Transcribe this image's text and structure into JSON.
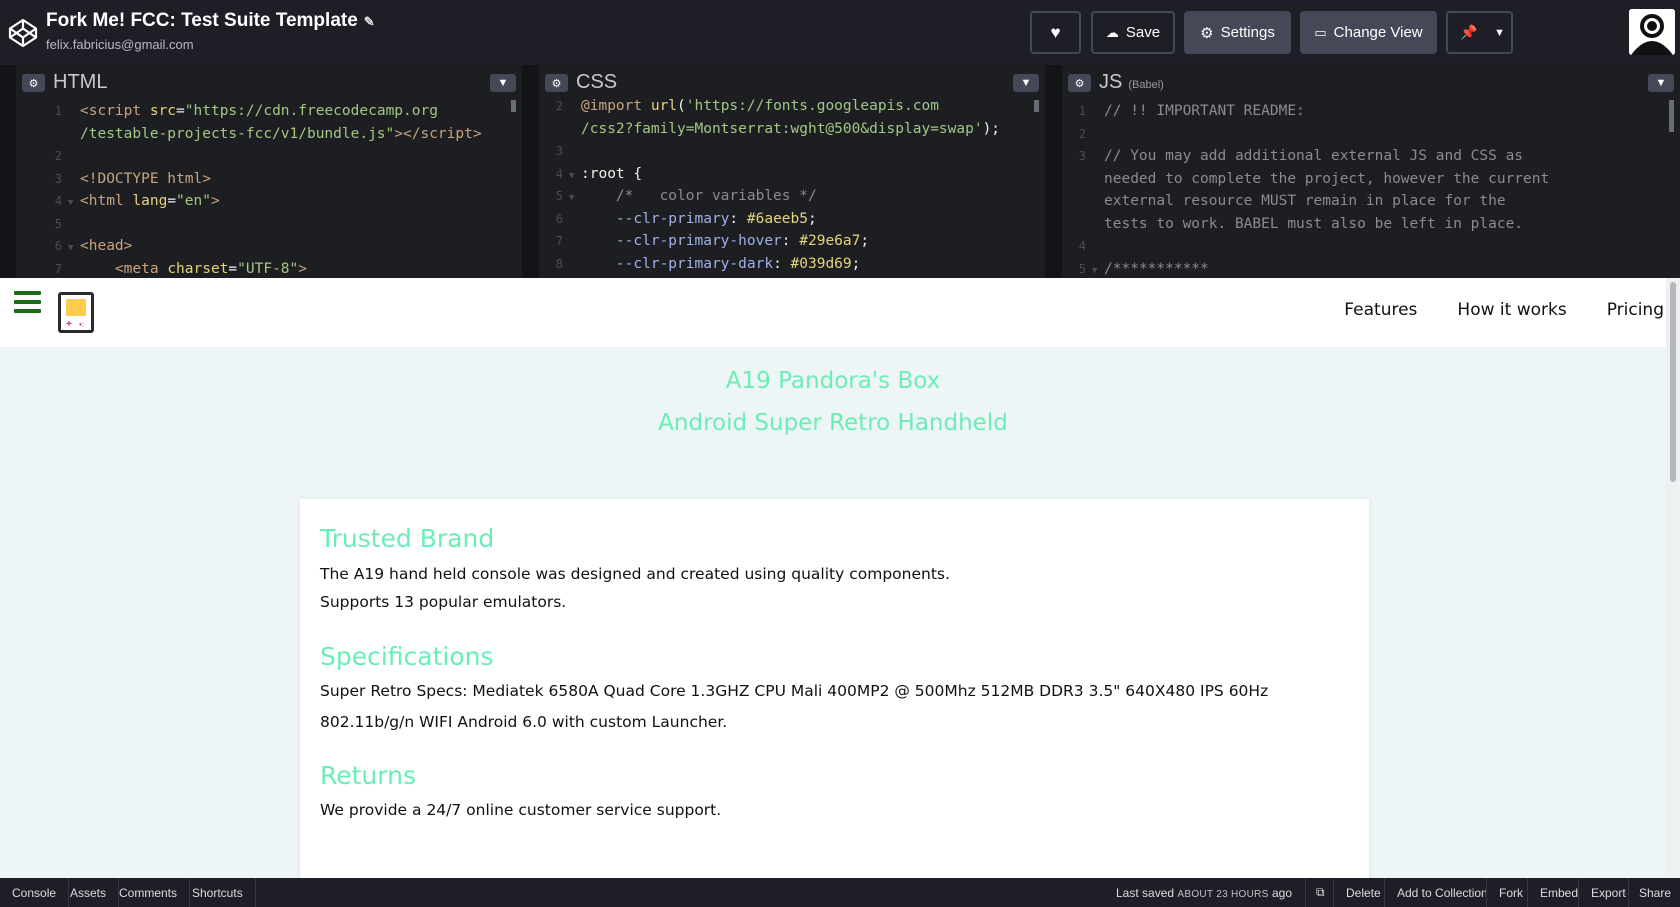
{
  "header": {
    "title": "Fork Me! FCC: Test Suite Template",
    "email": "felix.fabricius@gmail.com",
    "save_label": "Save",
    "settings_label": "Settings",
    "change_view_label": "Change View"
  },
  "editors": {
    "html": {
      "label": "HTML"
    },
    "css": {
      "label": "CSS"
    },
    "js": {
      "label": "JS",
      "sub": "(Babel)"
    }
  },
  "preview": {
    "nav": {
      "features": "Features",
      "how": "How it works",
      "pricing": "Pricing"
    },
    "hero_title": "A19 Pandora's Box",
    "hero_subtitle": "Android Super Retro Handheld",
    "sections": {
      "trusted_title": "Trusted Brand",
      "trusted_p1": "The A19 hand held console was designed and created using quality components.",
      "trusted_p2": "Supports 13 popular emulators.",
      "spec_title": "Specifications",
      "spec_p": "Super Retro Specs: Mediatek 6580A Quad Core 1.3GHZ CPU Mali 400MP2 @ 500Mhz 512MB DDR3 3.5\" 640X480 IPS 60Hz 802.11b/g/n WIFI Android 6.0 with custom Launcher.",
      "returns_title": "Returns",
      "returns_p": "We provide a 24/7 online customer service support."
    }
  },
  "footer": {
    "console": "Console",
    "assets": "Assets",
    "comments": "Comments",
    "shortcuts": "Shortcuts",
    "last_saved_prefix": "Last saved",
    "last_saved_time": "ABOUT 23 HOURS",
    "last_saved_suffix": "ago",
    "delete": "Delete",
    "add_collection": "Add to Collection",
    "fork": "Fork",
    "embed": "Embed",
    "export": "Export",
    "share": "Share"
  },
  "colors": {
    "accent": "#6aeeb5",
    "header_bg": "#1e1f26",
    "button_bg": "#444857"
  },
  "icons": [
    "codepen-logo-icon",
    "pencil-icon",
    "heart-icon",
    "cloud-icon",
    "gear-icon",
    "change-view-icon",
    "pin-icon",
    "chevron-down-icon",
    "hamburger-icon",
    "game-console-icon",
    "external-link-icon"
  ]
}
